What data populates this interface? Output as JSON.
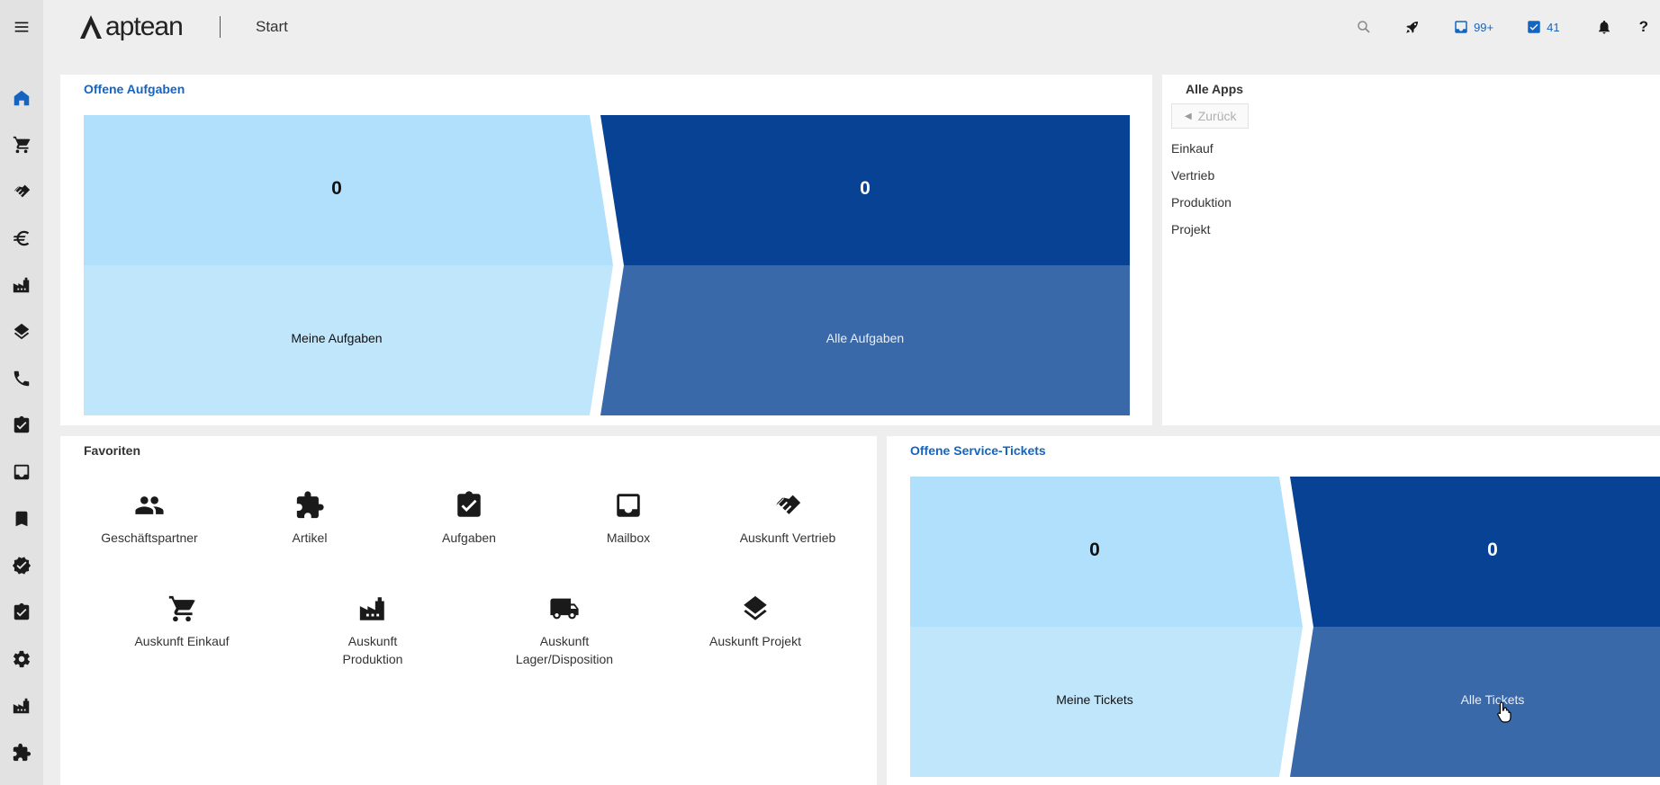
{
  "header": {
    "logo_text": "aptean",
    "title": "Start",
    "inbox_count": "99+",
    "tasks_count": "41",
    "help_label": "?"
  },
  "sidebar": {
    "items": [
      "menu",
      "home",
      "einkauf",
      "vertrieb",
      "finanzen",
      "produktion",
      "projekt",
      "service",
      "aufgaben",
      "mailbox",
      "lesezeichen",
      "qualitaet",
      "checklisten",
      "einstellungen",
      "fabrik",
      "artikel"
    ]
  },
  "offene_aufgaben": {
    "title": "Offene Aufgaben",
    "meine_count": "0",
    "meine_label": "Meine Aufgaben",
    "alle_count": "0",
    "alle_label": "Alle Aufgaben"
  },
  "alle_apps": {
    "title": "Alle Apps",
    "back_label": "Zurück",
    "items": [
      "Einkauf",
      "Vertrieb",
      "Produktion",
      "Projekt"
    ]
  },
  "favoriten": {
    "title": "Favoriten",
    "items": [
      {
        "label": "Geschäftspartner",
        "icon": "people-icon"
      },
      {
        "label": "Artikel",
        "icon": "puzzle-icon"
      },
      {
        "label": "Aufgaben",
        "icon": "task-icon"
      },
      {
        "label": "Mailbox",
        "icon": "inbox-icon"
      },
      {
        "label": "Auskunft Vertrieb",
        "icon": "handshake-icon"
      },
      {
        "label": "Auskunft Einkauf",
        "icon": "cart-icon"
      },
      {
        "label": "Auskunft Produktion",
        "icon": "factory-icon"
      },
      {
        "label": "Auskunft Lager/Disposition",
        "icon": "truck-icon"
      },
      {
        "label": "Auskunft Projekt",
        "icon": "layers-icon"
      }
    ]
  },
  "service_tickets": {
    "title": "Offene Service-Tickets",
    "meine_count": "0",
    "meine_label": "Meine Tickets",
    "alle_count": "0",
    "alle_label": "Alle Tickets"
  },
  "colors": {
    "accent": "#1565c0",
    "tile_light_top": "#b0e0fc",
    "tile_light_bottom": "#c0e6fb",
    "tile_dark_top": "#084294",
    "tile_dark_bottom": "#3a69aa"
  }
}
